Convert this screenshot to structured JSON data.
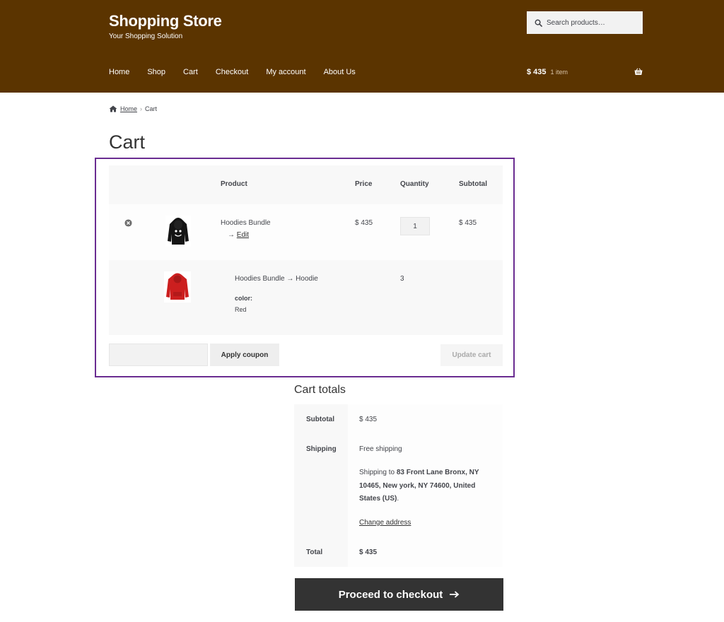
{
  "header": {
    "site_title": "Shopping Store",
    "site_description": "Your Shopping Solution",
    "search_placeholder": "Search products…",
    "nav": [
      "Home",
      "Shop",
      "Cart",
      "Checkout",
      "My account",
      "About Us"
    ],
    "cart_amount": "$ 435",
    "cart_count": "1 item",
    "colors": {
      "header_bg": "#5b3400",
      "highlight_border": "#6a2c91"
    }
  },
  "breadcrumb": {
    "home": "Home",
    "separator": "›",
    "current": "Cart"
  },
  "page_title": "Cart",
  "cart_table": {
    "headers": {
      "product": "Product",
      "price": "Price",
      "quantity": "Quantity",
      "subtotal": "Subtotal"
    },
    "items": [
      {
        "name": "Hoodies Bundle",
        "edit_arrow": "→",
        "edit_label": "Edit",
        "price": "$ 435",
        "quantity": "1",
        "subtotal": "$ 435",
        "image": "black-hoodie-thumbnail"
      },
      {
        "name": "Hoodies Bundle → Hoodie",
        "meta_label": "color:",
        "meta_value": "Red",
        "quantity": "3",
        "image": "red-hoodie-thumbnail"
      }
    ]
  },
  "actions": {
    "coupon_value": "",
    "apply_coupon": "Apply coupon",
    "update_cart": "Update cart"
  },
  "cart_totals": {
    "title": "Cart totals",
    "subtotal_label": "Subtotal",
    "subtotal_value": "$ 435",
    "shipping_label": "Shipping",
    "shipping_method": "Free shipping",
    "shipping_to_prefix": "Shipping to ",
    "shipping_address": "83 Front Lane Bronx, NY 10465, New york, NY 74600, United States (US)",
    "shipping_to_suffix": ".",
    "change_address": "Change address",
    "total_label": "Total",
    "total_value": "$ 435"
  },
  "checkout": {
    "label": "Proceed to checkout"
  }
}
